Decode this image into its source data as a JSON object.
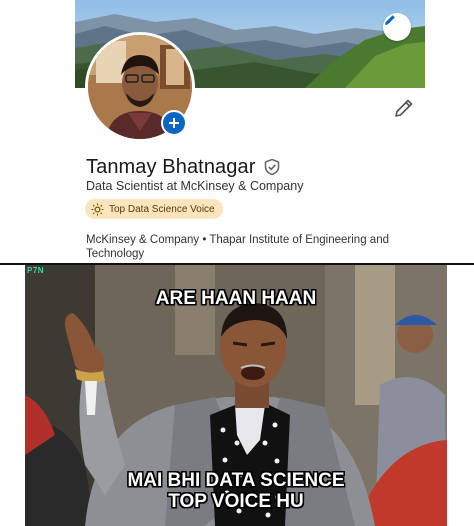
{
  "profile": {
    "name": "Tanmay Bhatnagar",
    "headline": "Data Scientist at McKinsey & Company",
    "badge": "Top Data Science Voice",
    "affiliations": "McKinsey & Company • Thapar Institute of Engineering and Technology",
    "icons": {
      "banner_edit": "pencil-icon",
      "profile_edit": "pencil-icon",
      "avatar_add": "plus-icon",
      "verified": "verified-shield-icon",
      "badge": "sun-icon"
    },
    "colors": {
      "accent": "#0a66c2",
      "badge_bg": "#fbe4be",
      "text": "#191919"
    }
  },
  "meme": {
    "watermark": "P7N",
    "top_caption": "ARE HAAN HAAN",
    "bottom_caption_line1": "MAI BHI DATA SCIENCE",
    "bottom_caption_line2": "TOP VOICE HU"
  }
}
